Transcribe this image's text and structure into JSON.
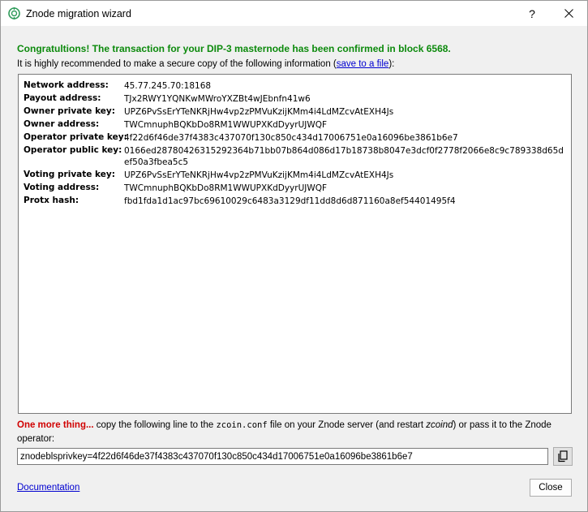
{
  "window": {
    "title": "Znode migration wizard",
    "help_label": "?",
    "close_label": "✕"
  },
  "header": {
    "congrats": "Congratultions! The transaction for your DIP-3 masternode has been confirmed in block 6568.",
    "recommend_prefix": "It is highly recommended to make a secure copy of the following information (",
    "save_link": "save to a file",
    "recommend_suffix": "):"
  },
  "info": [
    {
      "label": "Network address:",
      "value": "45.77.245.70:18168"
    },
    {
      "label": "Payout address:",
      "value": "TJx2RWY1YQNKwMWroYXZBt4wJEbnfn41w6"
    },
    {
      "label": "Owner private key:",
      "value": "UPZ6PvSsErYTeNKRjHw4vp2zPMVuKzijKMm4i4LdMZcvAtEXH4Js"
    },
    {
      "label": "Owner address:",
      "value": "TWCmnuphBQKbDo8RM1WWUPXKdDyyrUJWQF"
    },
    {
      "label": "Operator private key:",
      "value": "4f22d6f46de37f4383c437070f130c850c434d17006751e0a16096be3861b6e7"
    },
    {
      "label": "Operator public key:",
      "value": "0166ed28780426315292364b71bb07b864d086d17b18738b8047e3dcf0f2778f2066e8c9c789338d65def50a3fbea5c5"
    },
    {
      "label": "Voting private key:",
      "value": "UPZ6PvSsErYTeNKRjHw4vp2zPMVuKzijKMm4i4LdMZcvAtEXH4Js"
    },
    {
      "label": "Voting address:",
      "value": "TWCmnuphBQKbDo8RM1WWUPXKdDyyrUJWQF"
    },
    {
      "label": "Protx hash:",
      "value": "fbd1fda1d1ac97bc69610029c6483a3129df11dd8d6d871160a8ef54401495f4"
    }
  ],
  "footer": {
    "one_more": "One more thing...",
    "instr_1": " copy the following line to the ",
    "conf_file": "zcoin.conf",
    "instr_2": " file on your Znode server (and restart ",
    "daemon": "zcoind",
    "instr_3": ") or pass it to the Znode operator:",
    "command": "znodeblsprivkey=4f22d6f46de37f4383c437070f130c850c434d17006751e0a16096be3861b6e7",
    "copy_icon": "copy-icon",
    "doc_link": "Documentation",
    "close_button": "Close"
  },
  "colors": {
    "success": "#0c8a0c",
    "warning": "#d00000",
    "link": "#0000d0"
  }
}
